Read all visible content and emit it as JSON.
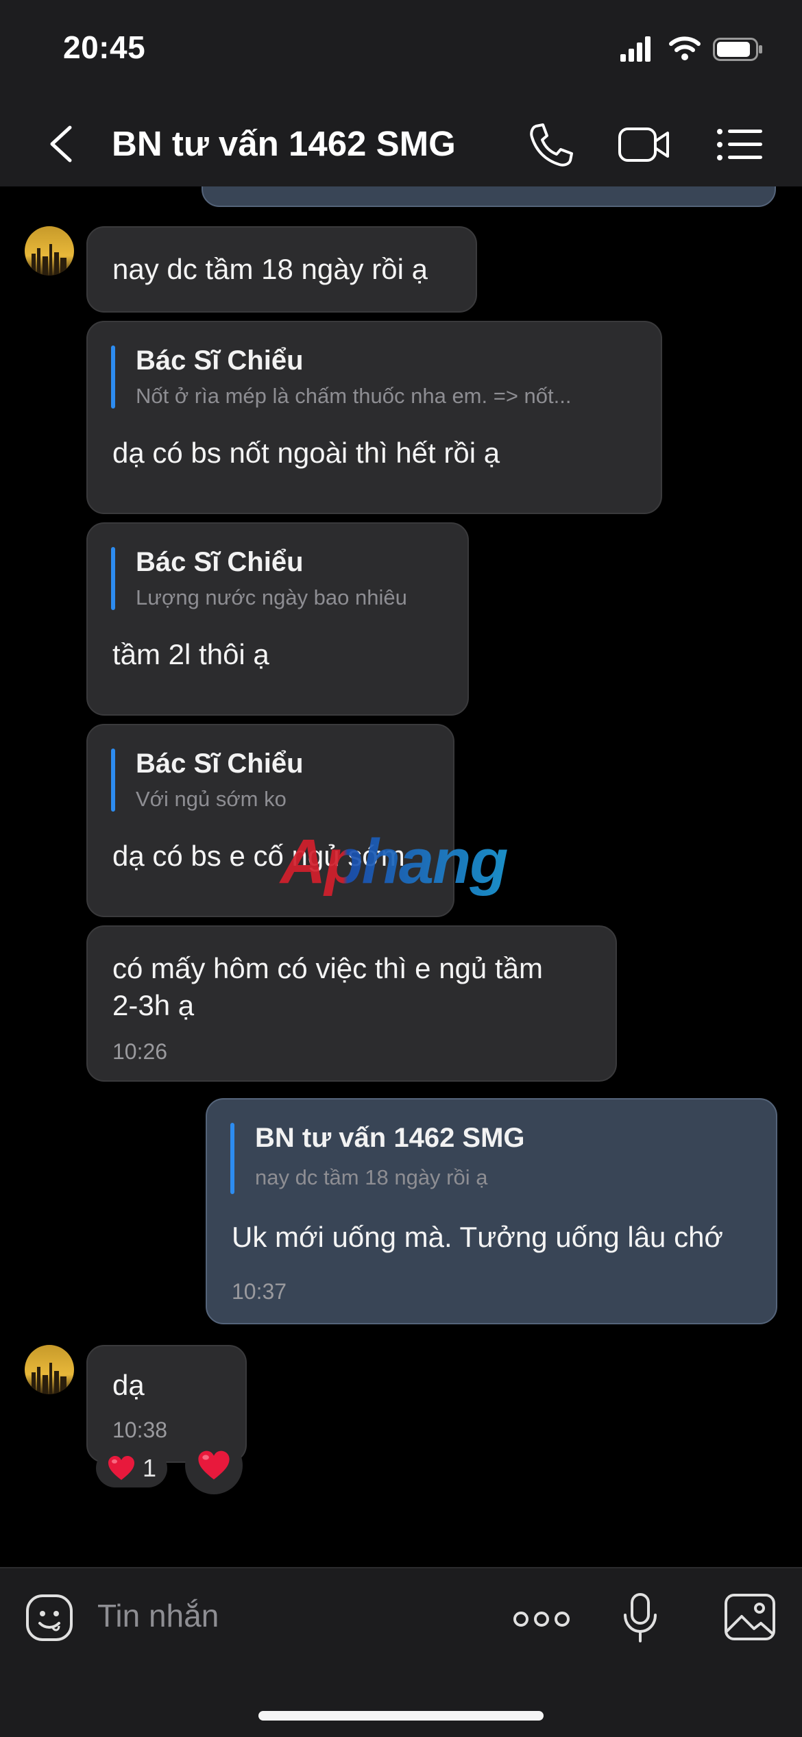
{
  "status_bar": {
    "time": "20:45"
  },
  "header": {
    "title": "BN tư vấn 1462 SMG"
  },
  "messages": [
    {
      "text": "nay dc tầm 18 ngày rồi ạ"
    },
    {
      "quote_name": "Bác Sĩ Chiểu",
      "quote_text": "Nốt ở rìa mép là chấm thuốc nha em. => nốt...",
      "text": "dạ có bs nốt ngoài thì hết rồi ạ"
    },
    {
      "quote_name": "Bác Sĩ Chiểu",
      "quote_text": "Lượng nước ngày bao nhiêu",
      "text": "tầm 2l thôi ạ"
    },
    {
      "quote_name": "Bác Sĩ Chiểu",
      "quote_text": "Với ngủ sớm ko",
      "text": "dạ có bs e cố ngủ sớm"
    },
    {
      "text_line1": "có mấy hôm có việc thì e ngủ tầm",
      "text_line2": "2-3h ạ",
      "time": "10:26"
    },
    {
      "quote_name": "BN tư vấn 1462 SMG",
      "quote_text": "nay dc tầm 18 ngày rồi ạ",
      "text": "Uk mới uống mà. Tưởng uống lâu chớ",
      "time": "10:37"
    },
    {
      "text": "dạ",
      "time": "10:38",
      "reaction_count": "1"
    }
  ],
  "watermark": "Aphang",
  "input": {
    "placeholder": "Tin nhắn"
  },
  "colors": {
    "quote_bar": "#2d8cf0",
    "incoming_bubble": "#2c2c2e",
    "outgoing_bubble": "#394556",
    "heart": "#e8193c"
  },
  "icons": [
    "back-icon",
    "phone-icon",
    "video-call-icon",
    "list-menu-icon",
    "sticker-icon",
    "more-options-icon",
    "microphone-icon",
    "image-icon",
    "heart-icon"
  ]
}
